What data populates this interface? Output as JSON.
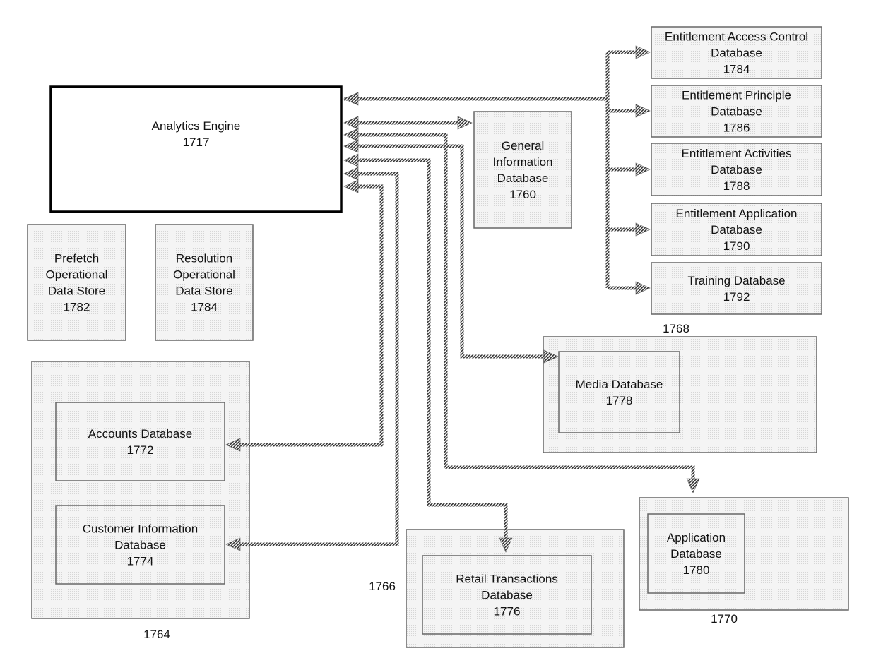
{
  "diagram": {
    "nodes": {
      "analytics_engine": {
        "lines": [
          "Analytics Engine",
          "1717"
        ]
      },
      "prefetch_ods": {
        "lines": [
          "Prefetch",
          "Operational",
          "Data Store",
          "1782"
        ]
      },
      "resolution_ods": {
        "lines": [
          "Resolution",
          "Operational",
          "Data Store",
          "1784"
        ]
      },
      "general_info_db": {
        "lines": [
          "General",
          "Information",
          "Database",
          "1760"
        ]
      },
      "ent_access_control_db": {
        "lines": [
          "Entitlement Access Control",
          "Database",
          "1784"
        ]
      },
      "ent_principle_db": {
        "lines": [
          "Entitlement Principle",
          "Database",
          "1786"
        ]
      },
      "ent_activities_db": {
        "lines": [
          "Entitlement Activities",
          "Database",
          "1788"
        ]
      },
      "ent_application_db": {
        "lines": [
          "Entitlement Application",
          "Database",
          "1790"
        ]
      },
      "training_db": {
        "lines": [
          "Training Database",
          "1792"
        ]
      },
      "media_db": {
        "lines": [
          "Media Database",
          "1778"
        ]
      },
      "accounts_db": {
        "lines": [
          "Accounts Database",
          "1772"
        ]
      },
      "customer_info_db": {
        "lines": [
          "Customer Information",
          "Database",
          "1774"
        ]
      },
      "retail_tx_db": {
        "lines": [
          "Retail Transactions",
          "Database",
          "1776"
        ]
      },
      "application_db": {
        "lines": [
          "Application",
          "Database",
          "1780"
        ]
      }
    },
    "groups": {
      "group_1764": {
        "label": "1764"
      },
      "group_1766": {
        "label": "1766"
      },
      "group_1768": {
        "label": "1768"
      },
      "group_1770": {
        "label": "1770"
      }
    },
    "edges": [
      {
        "from": "ent_access_control_db",
        "to": "analytics_engine",
        "note": "entitlement bus to engine"
      },
      {
        "from": "analytics_engine",
        "to": "ent_access_control_db"
      },
      {
        "from": "analytics_engine",
        "to": "ent_principle_db"
      },
      {
        "from": "analytics_engine",
        "to": "ent_activities_db"
      },
      {
        "from": "analytics_engine",
        "to": "ent_application_db"
      },
      {
        "from": "analytics_engine",
        "to": "training_db"
      },
      {
        "from": "analytics_engine",
        "to": "general_info_db",
        "bidirectional": true
      },
      {
        "from": "media_db",
        "to": "analytics_engine",
        "bidirectional": true
      },
      {
        "from": "application_db",
        "to": "analytics_engine",
        "bidirectional": true
      },
      {
        "from": "retail_tx_db",
        "to": "analytics_engine",
        "bidirectional": true
      },
      {
        "from": "customer_info_db",
        "to": "analytics_engine",
        "bidirectional": true
      },
      {
        "from": "accounts_db",
        "to": "analytics_engine",
        "bidirectional": true
      }
    ]
  }
}
